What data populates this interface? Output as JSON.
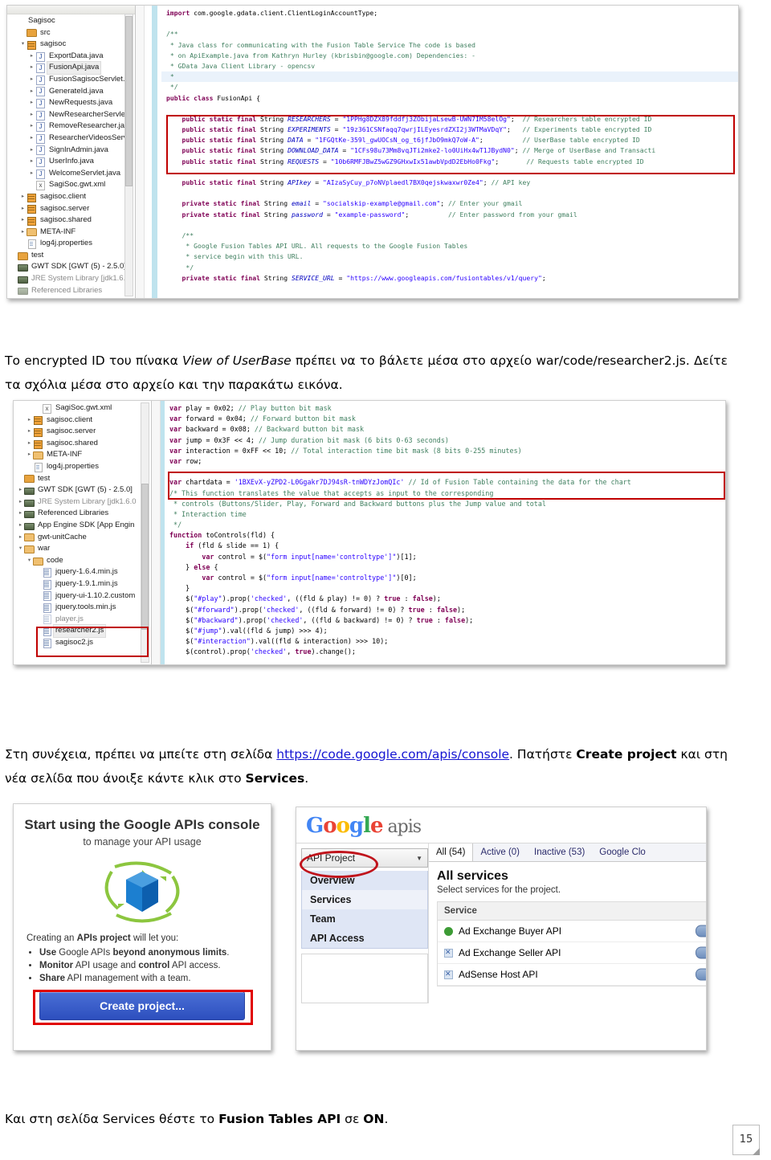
{
  "page": {
    "number": "15"
  },
  "figure1": {
    "tree": [
      {
        "indent": 0,
        "arrow": "",
        "icon": "none",
        "label": "Sagisoc"
      },
      {
        "indent": 0,
        "arrow": "",
        "icon": "folder",
        "label": "src"
      },
      {
        "indent": 0,
        "arrow": "open",
        "icon": "pkg",
        "label": "sagisoc"
      },
      {
        "indent": 1,
        "arrow": "closed",
        "icon": "java",
        "label": "ExportData.java"
      },
      {
        "indent": 1,
        "arrow": "closed",
        "icon": "java",
        "label": "FusionApi.java",
        "selected": true
      },
      {
        "indent": 1,
        "arrow": "closed",
        "icon": "java",
        "label": "FusionSagisocServlet.j"
      },
      {
        "indent": 1,
        "arrow": "closed",
        "icon": "java",
        "label": "GenerateId.java"
      },
      {
        "indent": 1,
        "arrow": "closed",
        "icon": "java",
        "label": "NewRequests.java"
      },
      {
        "indent": 1,
        "arrow": "closed",
        "icon": "java",
        "label": "NewResearcherServlet"
      },
      {
        "indent": 1,
        "arrow": "closed",
        "icon": "java",
        "label": "RemoveResearcher.jav"
      },
      {
        "indent": 1,
        "arrow": "closed",
        "icon": "java",
        "label": "ResearcherVideosServ"
      },
      {
        "indent": 1,
        "arrow": "closed",
        "icon": "java",
        "label": "SignInAdmin.java"
      },
      {
        "indent": 1,
        "arrow": "closed",
        "icon": "java",
        "label": "UserInfo.java"
      },
      {
        "indent": 1,
        "arrow": "closed",
        "icon": "java",
        "label": "WelcomeServlet.java"
      },
      {
        "indent": 1,
        "arrow": "",
        "icon": "xml",
        "label": "SagiSoc.gwt.xml"
      },
      {
        "indent": 0,
        "arrow": "closed",
        "icon": "pkg",
        "label": "sagisoc.client"
      },
      {
        "indent": 0,
        "arrow": "closed",
        "icon": "pkg",
        "label": "sagisoc.server"
      },
      {
        "indent": 0,
        "arrow": "closed",
        "icon": "pkg",
        "label": "sagisoc.shared"
      },
      {
        "indent": 0,
        "arrow": "closed",
        "icon": "folder2",
        "label": "META-INF"
      },
      {
        "indent": 0,
        "arrow": "",
        "icon": "file",
        "label": "log4j.properties"
      },
      {
        "indent": -1,
        "arrow": "",
        "icon": "folder",
        "label": "test"
      },
      {
        "indent": -1,
        "arrow": "",
        "icon": "lib",
        "label": "GWT SDK [GWT (5) - 2.5.0]"
      },
      {
        "indent": -1,
        "arrow": "",
        "icon": "lib",
        "label": "JRE System Library [jdk1.6.0",
        "dim": true
      },
      {
        "indent": -1,
        "arrow": "",
        "icon": "lib",
        "label": "Referenced Libraries",
        "faded": true
      }
    ],
    "code_lines": [
      {
        "text": "import com.google.gdata.client.ClientLoginAccountType;",
        "kind": "import"
      },
      {
        "text": "",
        "kind": "blank"
      },
      {
        "text": "/**",
        "kind": "cmt"
      },
      {
        "text": " * Java class for communicating with the Fusion Table Service The code is based",
        "kind": "cmt"
      },
      {
        "text": " * on ApiExample.java from Kathryn Hurley (kbrisbin@google.com) Dependencies: -",
        "kind": "cmt"
      },
      {
        "text": " * GData Java Client Library - opencsv",
        "kind": "cmt"
      },
      {
        "text": " *",
        "kind": "cmt-hl"
      },
      {
        "text": " */",
        "kind": "cmt"
      },
      {
        "text": "public class FusionApi {",
        "kind": "decl"
      },
      {
        "text": "",
        "kind": "blank"
      },
      {
        "text": "    public static final String RESEARCHERS = \"1PPHg8DZX89fddfj3ZObijaLsewB-UWN7IM58elOg\";  // Researchers table encrypted ID",
        "kind": "field"
      },
      {
        "text": "    public static final String EXPERIMENTS = \"19z361CSNfaqq7qwrjILEyesrdZXI2j3WTMaVDqY\";   // Experiments table encrypted ID",
        "kind": "field"
      },
      {
        "text": "    public static final String DATA = \"1FGQtKe-359l_gwUOCsN_og_t6jfJbO9mkQ7oW-A\";          // UserBase table encrypted ID",
        "kind": "field"
      },
      {
        "text": "    public static final String DOWNLOAD_DATA = \"1CFs98u73Mm8vqJTi2mke2-lo0UiHx4wT1JBydN0\"; // Merge of UserBase and Transacti",
        "kind": "field"
      },
      {
        "text": "    public static final String REQUESTS = \"10b6RMFJBwZ5wGZ9GHxwIx51awbVpdD2EbHo0Fkg\";       // Requests table encrypted ID",
        "kind": "field"
      },
      {
        "text": "",
        "kind": "blank"
      },
      {
        "text": "    public static final String APIkey = \"AIzaSyCuy_p7oNVplaedl7BX0qejskwaxwr0Ze4\"; // API key",
        "kind": "field"
      },
      {
        "text": "",
        "kind": "blank"
      },
      {
        "text": "    private static final String email = \"socialskip-example@gmail.com\"; // Enter your gmail",
        "kind": "field"
      },
      {
        "text": "    private static final String password = \"example-password\";          // Enter password from your gmail",
        "kind": "field"
      },
      {
        "text": "",
        "kind": "blank"
      },
      {
        "text": "    /**",
        "kind": "cmt"
      },
      {
        "text": "     * Google Fusion Tables API URL. All requests to the Google Fusion Tables",
        "kind": "cmt"
      },
      {
        "text": "     * service begin with this URL.",
        "kind": "cmt"
      },
      {
        "text": "     */",
        "kind": "cmt"
      },
      {
        "text": "    private static final String SERVICE_URL = \"https://www.googleapis.com/fusiontables/v1/query\";",
        "kind": "field"
      }
    ],
    "highlight_note": "red box around the five table ID constants"
  },
  "para1": {
    "part1": "Το encrypted ID του πίνακα ",
    "italic": "View of UserBase",
    "part2": " πρέπει να το βάλετε μέσα στο αρχείο war/code/researcher2.js. Δείτε τα σχόλια μέσα στο αρχείο και την παρακάτω εικόνα."
  },
  "figure2": {
    "tree": [
      {
        "indent": 1,
        "arrow": "",
        "icon": "xml",
        "label": "SagiSoc.gwt.xml"
      },
      {
        "indent": 0,
        "arrow": "closed",
        "icon": "pkg",
        "label": "sagisoc.client"
      },
      {
        "indent": 0,
        "arrow": "closed",
        "icon": "pkg",
        "label": "sagisoc.server"
      },
      {
        "indent": 0,
        "arrow": "closed",
        "icon": "pkg",
        "label": "sagisoc.shared"
      },
      {
        "indent": 0,
        "arrow": "closed",
        "icon": "folder2",
        "label": "META-INF"
      },
      {
        "indent": 0,
        "arrow": "",
        "icon": "file",
        "label": "log4j.properties"
      },
      {
        "indent": -1,
        "arrow": "",
        "icon": "folder",
        "label": "test"
      },
      {
        "indent": -1,
        "arrow": "closed",
        "icon": "lib",
        "label": "GWT SDK [GWT (5) - 2.5.0]"
      },
      {
        "indent": -1,
        "arrow": "closed",
        "icon": "lib",
        "label": "JRE System Library [jdk1.6.0",
        "dim": true
      },
      {
        "indent": -1,
        "arrow": "closed",
        "icon": "lib",
        "label": "Referenced Libraries"
      },
      {
        "indent": -1,
        "arrow": "closed",
        "icon": "lib",
        "label": "App Engine SDK [App Engin"
      },
      {
        "indent": -1,
        "arrow": "closed",
        "icon": "folder2",
        "label": "gwt-unitCache"
      },
      {
        "indent": -1,
        "arrow": "open",
        "icon": "folder2",
        "label": "war"
      },
      {
        "indent": 0,
        "arrow": "open",
        "icon": "folder2",
        "label": "code"
      },
      {
        "indent": 1,
        "arrow": "",
        "icon": "jsf",
        "label": "jquery-1.6.4.min.js"
      },
      {
        "indent": 1,
        "arrow": "",
        "icon": "jsf",
        "label": "jquery-1.9.1.min.js"
      },
      {
        "indent": 1,
        "arrow": "",
        "icon": "jsf",
        "label": "jquery-ui-1.10.2.custom"
      },
      {
        "indent": 1,
        "arrow": "",
        "icon": "jsf",
        "label": "jquery.tools.min.js"
      },
      {
        "indent": 1,
        "arrow": "",
        "icon": "jsf",
        "label": "player.js",
        "faded": true
      },
      {
        "indent": 1,
        "arrow": "",
        "icon": "jsf",
        "label": "researcher2.js",
        "selected": true
      },
      {
        "indent": 1,
        "arrow": "",
        "icon": "jsf",
        "label": "sagisoc2.js"
      }
    ],
    "code_lines": [
      {
        "text": "var play = 0x02; // Play button bit mask"
      },
      {
        "text": "var forward = 0x04; // Forward button bit mask"
      },
      {
        "text": "var backward = 0x08; // Backward button bit mask"
      },
      {
        "text": "var jump = 0x3F << 4; // Jump duration bit mask (6 bits 0-63 seconds)"
      },
      {
        "text": "var interaction = 0xFF << 10; // Total interaction time bit mask (8 bits 0-255 minutes)"
      },
      {
        "text": "var row;"
      },
      {
        "text": ""
      },
      {
        "text": "var chartdata = '1BXEvX-yZPD2-L0Ggakr7DJ94sR-tnWDYzJomQIc' // Id of Fusion Table containing the data for the chart"
      },
      {
        "text": "/* This function translates the value that accepts as input to the corresponding"
      },
      {
        "text": " * controls (Buttons/Slider, Play, Forward and Backward buttons plus the Jump value and total"
      },
      {
        "text": " * Interaction time"
      },
      {
        "text": " */"
      },
      {
        "text": "function toControls(fld) {"
      },
      {
        "text": "    if (fld & slide == 1) {"
      },
      {
        "text": "        var control = $(\"form input[name='controltype']\")[1];"
      },
      {
        "text": "    } else {"
      },
      {
        "text": "        var control = $(\"form input[name='controltype']\")[0];"
      },
      {
        "text": "    }"
      },
      {
        "text": "    $(\"#play\").prop('checked', ((fld & play) != 0) ? true : false);"
      },
      {
        "text": "    $(\"#forward\").prop('checked', ((fld & forward) != 0) ? true : false);"
      },
      {
        "text": "    $(\"#backward\").prop('checked', ((fld & backward) != 0) ? true : false);"
      },
      {
        "text": "    $(\"#jump\").val((fld & jump) >>> 4);"
      },
      {
        "text": "    $(\"#interaction\").val((fld & interaction) >>> 10);"
      },
      {
        "text": "    $(control).prop('checked', true).change();"
      }
    ],
    "highlight_note": "red box around the chartdata line and around researcher2.js in the tree"
  },
  "para2": {
    "part1": "Στη συνέχεια, πρέπει να μπείτε στη σελίδα ",
    "link": "https://code.google.com/apis/console",
    "part2": ". Πατήστε ",
    "bold1": "Create project",
    "part3": " και στη νέα σελίδα που άνοιξε κάντε κλικ στο ",
    "bold2": "Services",
    "part4": "."
  },
  "figure3": {
    "title": "Start using the Google APIs console",
    "subtitle": "to manage your API usage",
    "lead": "Creating an APIs project will let you:",
    "lead_bold": "APIs project",
    "bullets": [
      {
        "bold": "Use",
        "mid": " Google APIs ",
        "bold2": "beyond anonymous limits",
        "tail": "."
      },
      {
        "bold": "Monitor",
        "mid": " API usage and ",
        "bold2": "control",
        "tail": " API access."
      },
      {
        "bold": "Share",
        "mid": " API management with a team.",
        "bold2": "",
        "tail": ""
      }
    ],
    "button": "Create project..."
  },
  "figure4": {
    "logo": {
      "g1": "G",
      "o1": "o",
      "o2": "o",
      "g2": "g",
      "l": "l",
      "e": "e",
      "apis": "apis"
    },
    "project_select": "API Project",
    "nav": [
      "Overview",
      "Services",
      "Team",
      "API Access"
    ],
    "nav_active": "Services",
    "tabs": [
      "All (54)",
      "Active (0)",
      "Inactive (53)",
      "Google Clo"
    ],
    "tab_active": "All (54)",
    "heading": "All services",
    "subheading": "Select services for the project.",
    "table_header": "Service",
    "rows": [
      {
        "name": "Ad Exchange Buyer API",
        "icon": "green"
      },
      {
        "name": "Ad Exchange Seller API",
        "icon": "blue"
      },
      {
        "name": "AdSense Host API",
        "icon": "blue"
      }
    ]
  },
  "para3": {
    "part1": "Και στη σελίδα Services θέστε το ",
    "bold1": "Fusion Tables API",
    "part2": " σε ",
    "bold2": "ON",
    "part3": "."
  },
  "colors": {
    "red_highlight": "#c00000",
    "link": "#1414d2",
    "google_blue": "#4285F4",
    "button_blue": "#2d4fbe"
  }
}
